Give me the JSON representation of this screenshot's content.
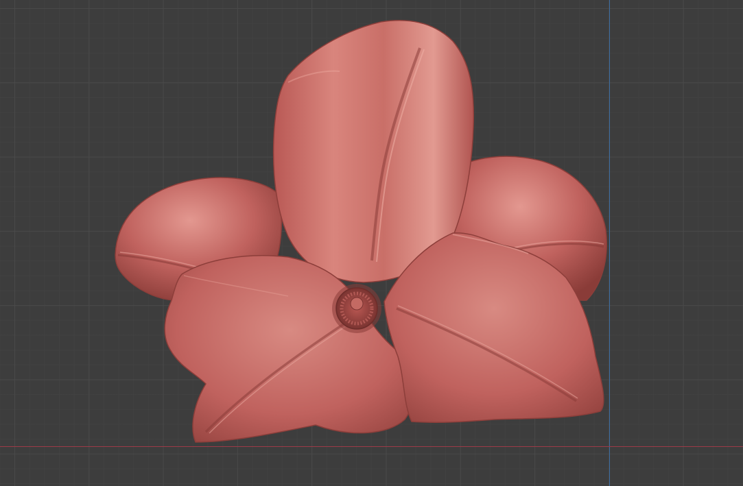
{
  "viewport": {
    "background_color": "#3d3d3d",
    "grid_color": "#4a4a4a",
    "x_axis_color": "#9c3a48",
    "y_axis_color": "#3d6ea3"
  },
  "model": {
    "name": "flower-sculpt",
    "base_color": "#c0625e",
    "highlight_color": "#e59a90",
    "shadow_color": "#7c3431",
    "petal_count": 5
  }
}
